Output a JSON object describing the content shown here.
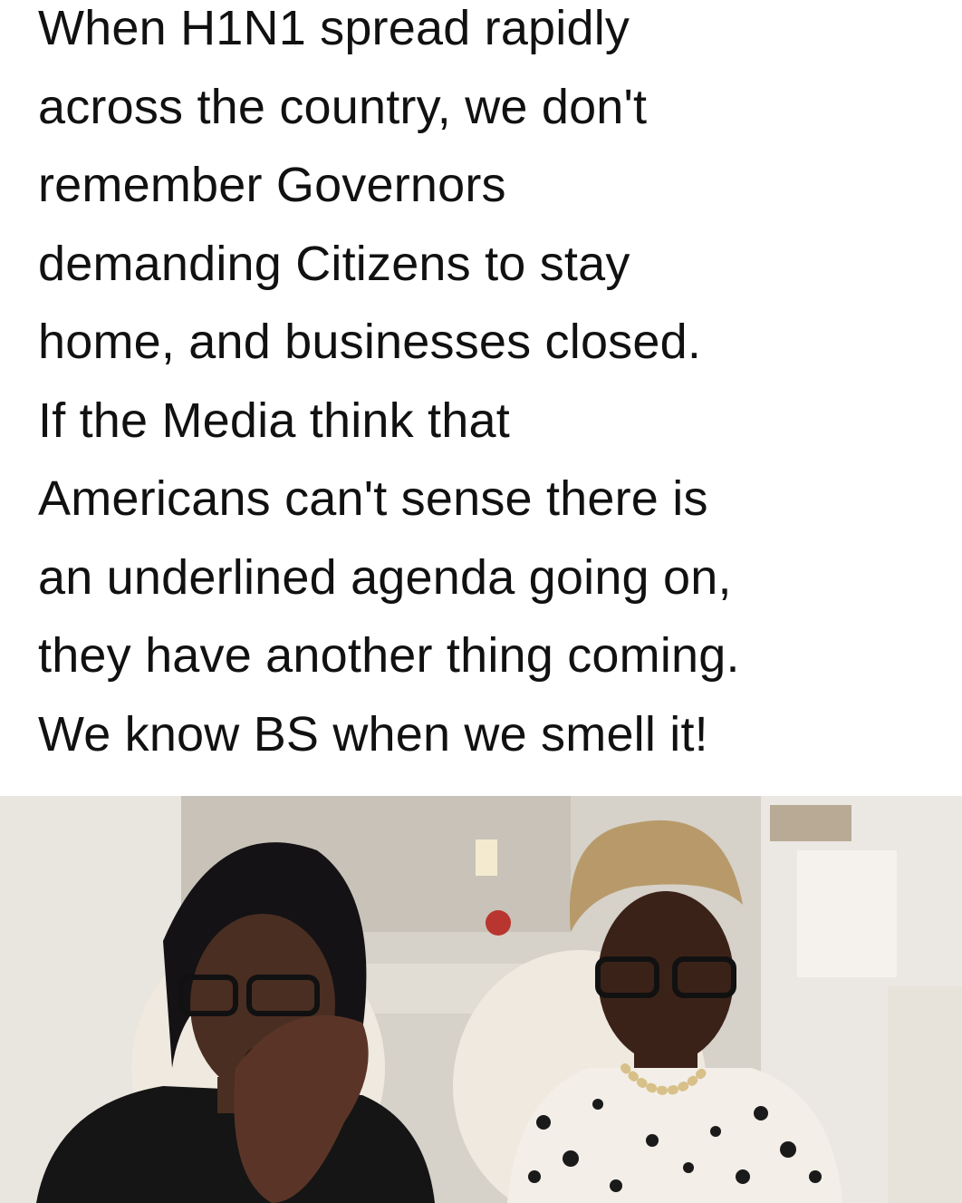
{
  "post": {
    "lines": [
      "When H1N1 spread rapidly",
      "across the country, we don't",
      "remember Governors",
      "demanding Citizens to stay",
      "home, and businesses closed.",
      "If the Media think that",
      "Americans can't sense there is",
      "an underlined agenda going on,",
      "they have another thing coming.",
      "We know BS when we smell it!"
    ]
  },
  "photo": {
    "description_icon": "photo-of-two-women-talking-to-camera"
  },
  "colors": {
    "text": "#111111",
    "background": "#ffffff",
    "wall": "#d9d4cd",
    "wall_light": "#ece8e2"
  }
}
